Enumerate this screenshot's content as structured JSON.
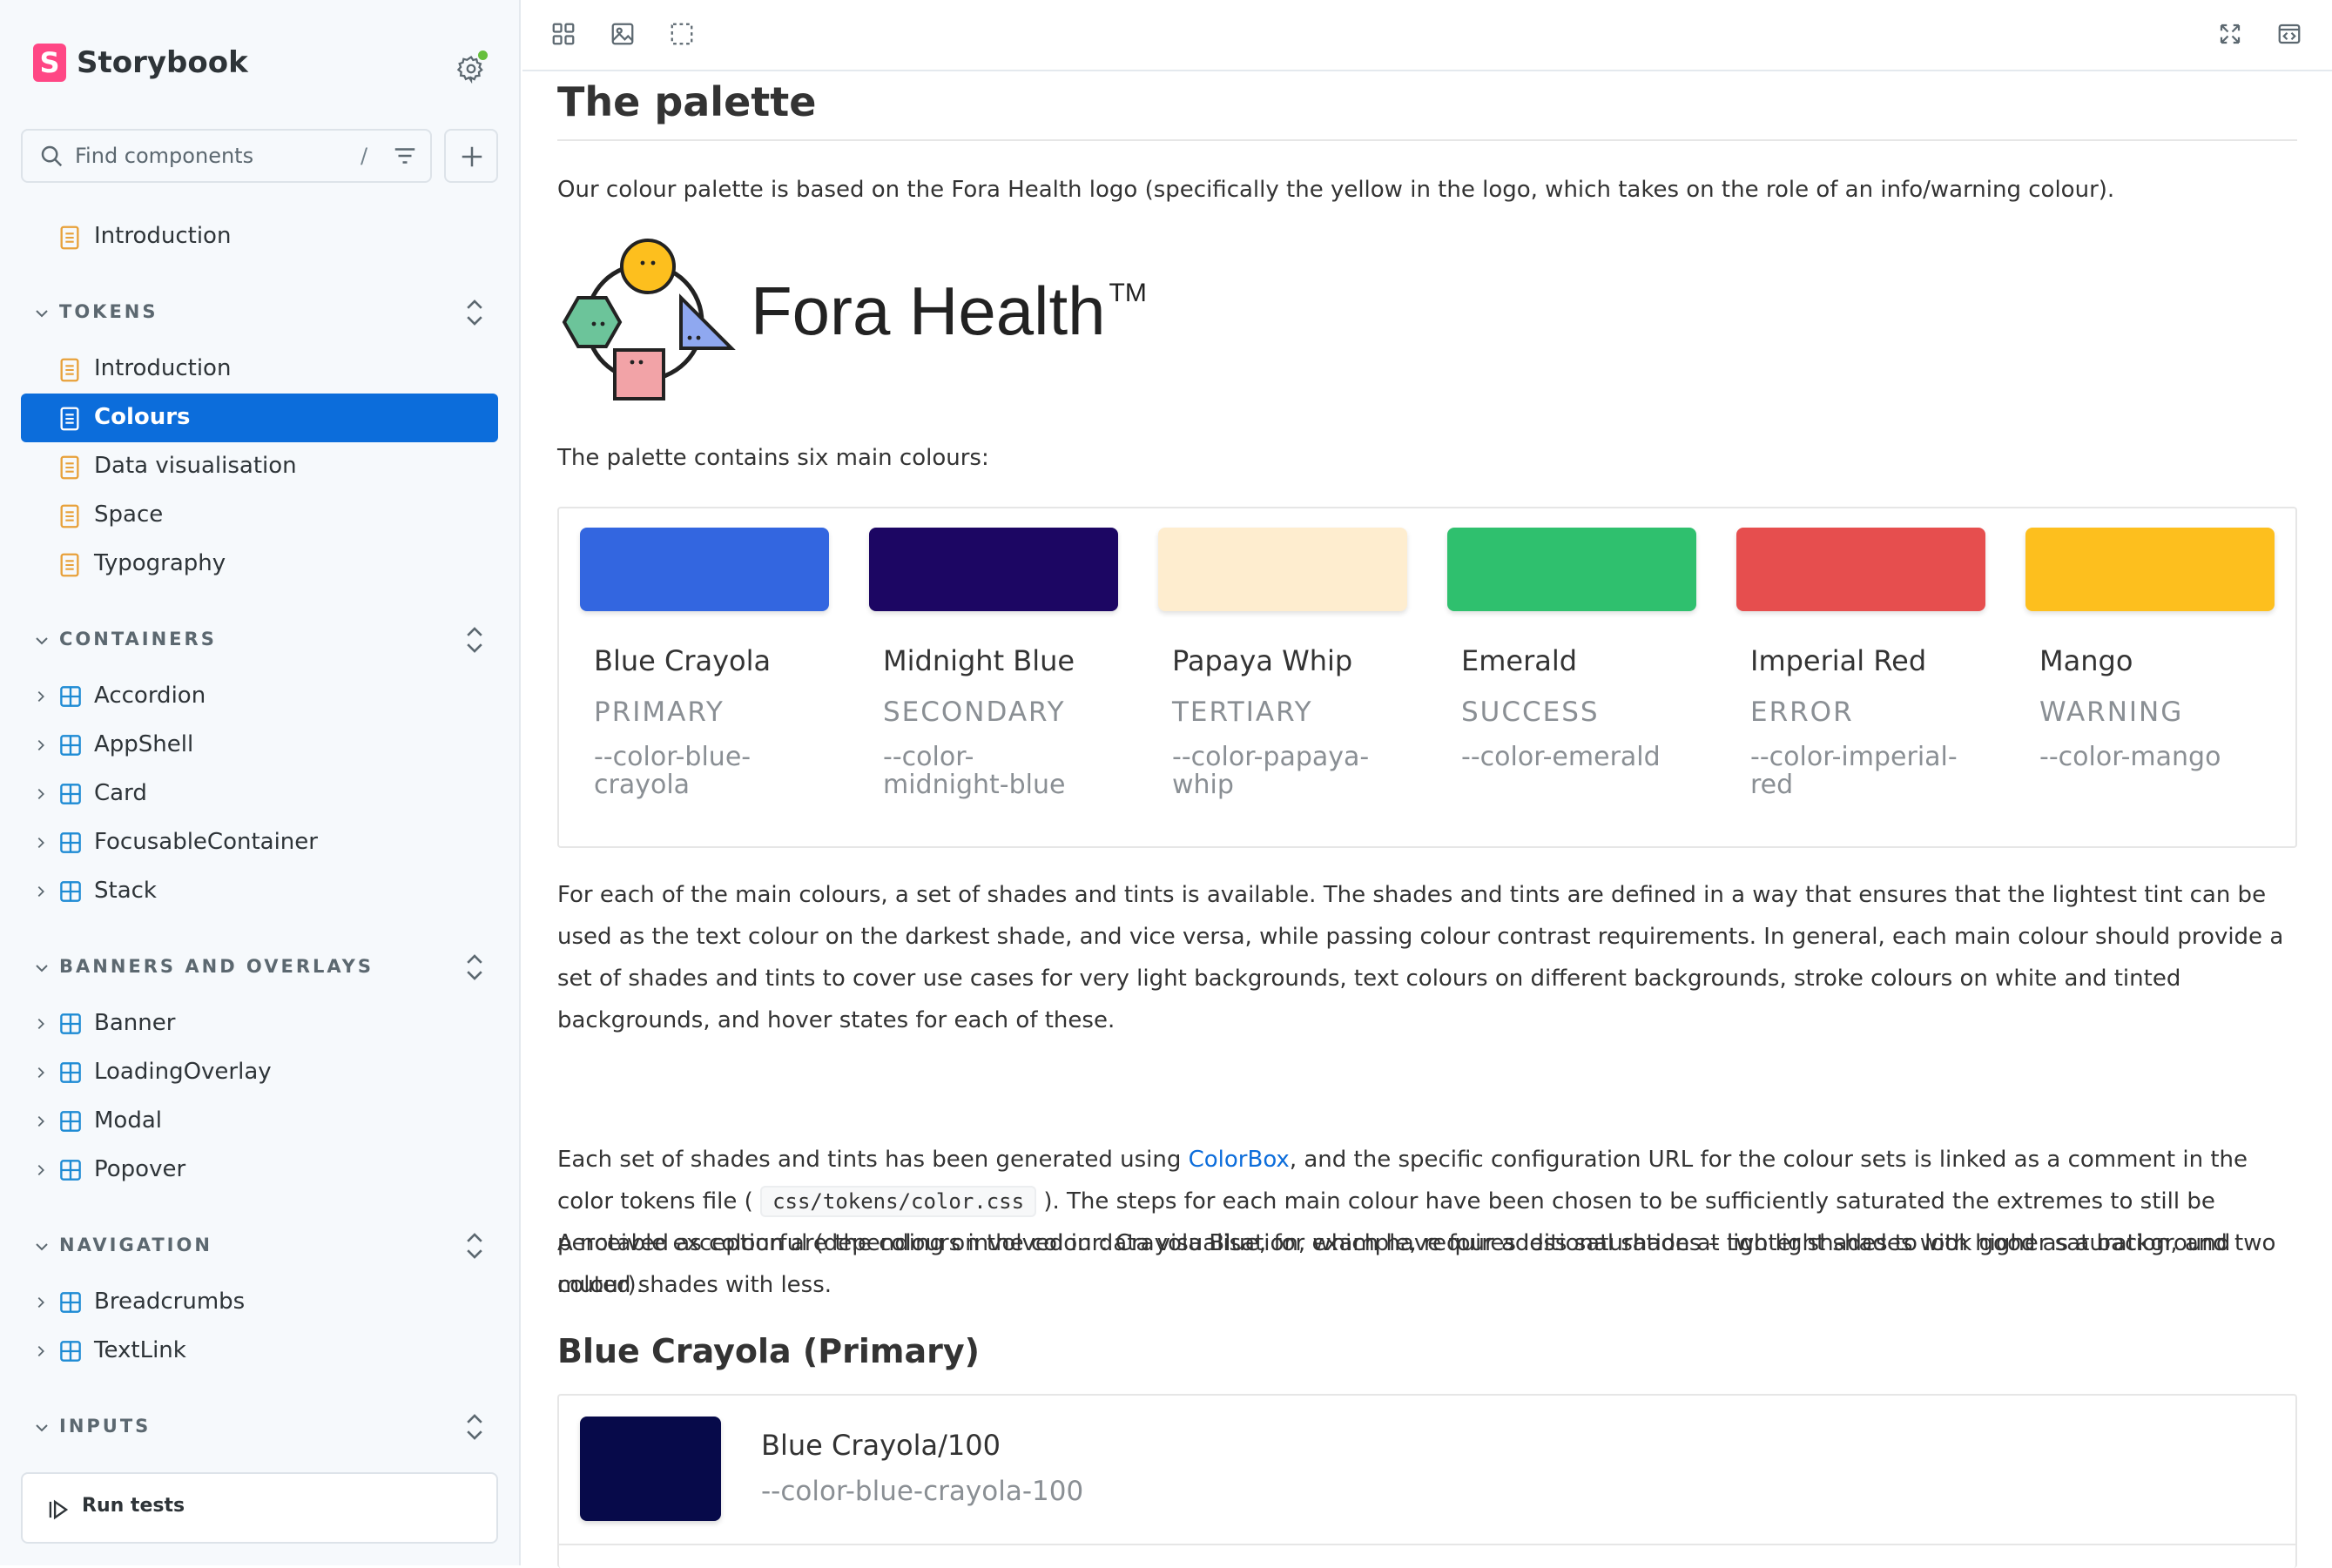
{
  "brand": {
    "name": "Storybook",
    "logo_letter": "S"
  },
  "search": {
    "placeholder": "Find components",
    "shortcut": "/"
  },
  "sidebar": {
    "top_item": "Introduction",
    "groups": [
      {
        "label": "TOKENS",
        "items": [
          "Introduction",
          "Colours",
          "Data visualisation",
          "Space",
          "Typography"
        ]
      },
      {
        "label": "CONTAINERS",
        "items": [
          "Accordion",
          "AppShell",
          "Card",
          "FocusableContainer",
          "Stack"
        ]
      },
      {
        "label": "BANNERS AND OVERLAYS",
        "items": [
          "Banner",
          "LoadingOverlay",
          "Modal",
          "Popover"
        ]
      },
      {
        "label": "NAVIGATION",
        "items": [
          "Breadcrumbs",
          "TextLink"
        ]
      },
      {
        "label": "INPUTS",
        "items": []
      }
    ],
    "active_item": "Colours",
    "run_tests": "Run tests"
  },
  "doc": {
    "title": "The palette",
    "intro": "Our colour palette is based on the Fora Health logo (specifically the yellow in the logo, which takes on the role of an info/warning colour).",
    "logo_text": "Fora Health",
    "logo_tm": "TM",
    "palette_intro": "The palette contains six main colours:",
    "palette": [
      {
        "name": "Blue Crayola",
        "role": "PRIMARY",
        "var": "--color-blue-crayola",
        "color": "#3366e0"
      },
      {
        "name": "Midnight Blue",
        "role": "SECONDARY",
        "var": "--color-midnight-blue",
        "color": "#1c0663"
      },
      {
        "name": "Papaya Whip",
        "role": "TERTIARY",
        "var": "--color-papaya-whip",
        "color": "#feedcf"
      },
      {
        "name": "Emerald",
        "role": "SUCCESS",
        "var": "--color-emerald",
        "color": "#2fc06e"
      },
      {
        "name": "Imperial Red",
        "role": "ERROR",
        "var": "--color-imperial-red",
        "color": "#e64e4e"
      },
      {
        "name": "Mango",
        "role": "WARNING",
        "var": "--color-mango",
        "color": "#fdbf1e"
      }
    ],
    "p1": "For each of the main colours, a set of shades and tints is available. The shades and tints are defined in a way that ensures that the lightest tint can be used as the text colour on the darkest shade, and vice versa, while passing colour contrast requirements. In general, each main colour should provide a set of shades and tints to cover use cases for very light backgrounds, text colours on different backgrounds, stroke colours on white and tinted backgrounds, and hover states for each of these.",
    "p2_a": "Each set of shades and tints has been generated using ",
    "p2_link": "ColorBox",
    "p2_b": ", and the specific configuration URL for the colour sets is linked as a comment in the color tokens file ( ",
    "p2_code": "css/tokens/color.css",
    "p2_c": " ). The steps for each main colour have been chosen to be sufficiently saturated the extremes to still be perceived as colourful (depending on the colour: Crayola Blue, for example, requires less saturation at lighter shades to look good as a background colour).",
    "p3": "A notable exception are the colours involved in data visualisation, which have four additional shades – two light shades with higher saturation, and two muted shades with less.",
    "section_title": "Blue Crayola (Primary)",
    "shade": {
      "name": "Blue Crayola/100",
      "var": "--color-blue-crayola-100",
      "color": "#070a4a"
    }
  },
  "colors": {
    "accent": "#0c6ddb",
    "doc_icon": "#e8a13a",
    "comp_icon": "#1e8bd4"
  }
}
